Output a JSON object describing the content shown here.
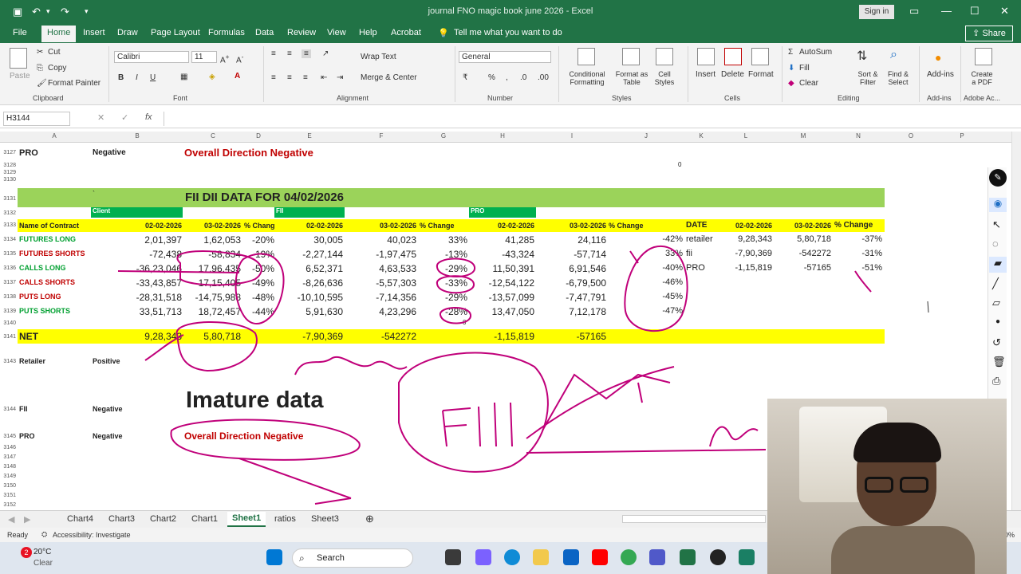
{
  "app": {
    "title": "journal FNO magic book june 2026  -  Excel",
    "signin": "Sign in",
    "share": "Share"
  },
  "ribbon_tabs": [
    "File",
    "Home",
    "Insert",
    "Draw",
    "Page Layout",
    "Formulas",
    "Data",
    "Review",
    "View",
    "Help",
    "Acrobat",
    "Tell me what you want to do"
  ],
  "ribbon": {
    "clipboard": {
      "paste": "Paste",
      "cut": "Cut",
      "copy": "Copy",
      "format_painter": "Format Painter",
      "label": "Clipboard"
    },
    "font": {
      "name": "Calibri",
      "size": "11",
      "bold": "B",
      "italic": "I",
      "underline": "U",
      "label": "Font"
    },
    "alignment": {
      "wrap": "Wrap Text",
      "merge": "Merge & Center",
      "label": "Alignment"
    },
    "number": {
      "format": "General",
      "label": "Number"
    },
    "styles": {
      "conditional": "Conditional Formatting",
      "format_table": "Format as Table",
      "cell_styles": "Cell Styles",
      "label": "Styles"
    },
    "cells": {
      "insert": "Insert",
      "delete": "Delete",
      "format": "Format",
      "label": "Cells"
    },
    "editing": {
      "autosum": "AutoSum",
      "fill": "Fill",
      "clear": "Clear",
      "sort": "Sort & Filter",
      "find": "Find & Select",
      "label": "Editing"
    },
    "addins": {
      "addins": "Add-ins",
      "label": "Add-ins"
    },
    "adobe": {
      "create_pdf": "Create a PDF",
      "label": "Adobe Ac..."
    }
  },
  "formula_bar": {
    "name_box": "H3144",
    "fx": "fx",
    "value": ""
  },
  "columns": [
    "A",
    "B",
    "C",
    "D",
    "E",
    "F",
    "G",
    "H",
    "I",
    "J",
    "K",
    "L",
    "M",
    "N",
    "O",
    "P"
  ],
  "rows": {
    "r3127": {
      "num": "3127",
      "a": "PRO",
      "b": "Negative",
      "c": "Overall Direction Negative"
    },
    "r3128": {
      "num": "3128",
      "j": "0"
    },
    "r3129": {
      "num": "3129"
    },
    "r3130": {
      "num": "3130"
    },
    "r3131": {
      "num": "3131",
      "b": "`",
      "title": "FII DII DATA  FOR  04/02/2026"
    },
    "r3132": {
      "num": "3132",
      "client": "Client",
      "fii": "FII",
      "pro": "PRO"
    },
    "r3133": {
      "num": "3133",
      "cells": [
        "Name of Contract",
        "02-02-2026",
        "03-02-2026",
        "% Chang",
        "02-02-2026",
        "03-02-2026",
        "% Change",
        "02-02-2026",
        "03-02-2026",
        "% Change",
        "DATE",
        "02-02-2026",
        "03-02-2026",
        "% Change"
      ]
    },
    "data": [
      {
        "num": "3134",
        "name": "FUTURES LONG",
        "cls": "green",
        "v": [
          "2,01,397",
          "1,62,053",
          "-20%",
          "30,005",
          "40,023",
          "33%",
          "41,285",
          "24,116",
          "-42%",
          "retailer",
          "9,28,343",
          "5,80,718",
          "-37%"
        ]
      },
      {
        "num": "3135",
        "name": "FUTURES SHORTS",
        "cls": "red",
        "v": [
          "-72,438",
          "-58,834",
          "-19%",
          "-2,27,144",
          "-1,97,475",
          "-13%",
          "-43,324",
          "-57,714",
          "33%",
          "fii",
          "-7,90,369",
          "-542272",
          "-31%"
        ]
      },
      {
        "num": "3136",
        "name": "CALLS LONG",
        "cls": "green",
        "v": [
          "-36,23,046",
          "17,96,435",
          "-50%",
          "6,52,371",
          "4,63,533",
          "-29%",
          "11,50,391",
          "6,91,546",
          "-40%",
          "PRO",
          "-1,15,819",
          "-57165",
          "-51%"
        ]
      },
      {
        "num": "3137",
        "name": "CALLS SHORTS",
        "cls": "red",
        "v": [
          "-33,43,857",
          "-17,15,405",
          "-49%",
          "-8,26,636",
          "-5,57,303",
          "-33%",
          "-12,54,122",
          "-6,79,500",
          "-46%",
          "",
          "",
          "",
          ""
        ]
      },
      {
        "num": "3138",
        "name": "PUTS LONG",
        "cls": "red",
        "v": [
          "-28,31,518",
          "-14,75,988",
          "-48%",
          "-10,10,595",
          "-7,14,356",
          "-29%",
          "-13,57,099",
          "-7,47,791",
          "-45%",
          "",
          "",
          "",
          ""
        ]
      },
      {
        "num": "3139",
        "name": "PUTS SHORTS",
        "cls": "green",
        "v": [
          "33,51,713",
          "18,72,457",
          "-44%",
          "5,91,630",
          "4,23,296",
          "-28%",
          "13,47,050",
          "7,12,178",
          "-47%",
          "",
          "",
          "",
          ""
        ]
      }
    ],
    "r3140": {
      "num": "3140",
      "g": "0"
    },
    "r3141": {
      "num": "3141",
      "a": "NET",
      "b": "9,28,343",
      "c": "5,80,718",
      "e": "-7,90,369",
      "f": "-542272",
      "h": "-1,15,819",
      "i": "-57165"
    },
    "r3143": {
      "num": "3143",
      "a": "Retailer",
      "b": "Positive"
    },
    "r3144": {
      "num": "3144",
      "a": "FII",
      "b": "Negative",
      "big": "Imature data"
    },
    "r3145": {
      "num": "3145",
      "a": "PRO",
      "b": "Negative",
      "c": "Overall Direction Negative"
    },
    "blank": [
      "3146",
      "3147",
      "3148",
      "3149",
      "3150",
      "3151",
      "3152"
    ]
  },
  "sheet_tabs": [
    "Chart4",
    "Chart3",
    "Chart2",
    "Chart1",
    "Sheet1",
    "ratios",
    "Sheet3"
  ],
  "active_sheet": "Sheet1",
  "status": {
    "ready": "Ready",
    "accessibility": "Accessibility: Investigate",
    "zoom": "70%"
  },
  "taskbar": {
    "weather_temp": "20°C",
    "weather_desc": "Clear",
    "badge": "2",
    "search": "Search"
  },
  "colors": {
    "excel_green": "#217346",
    "header_green": "#9bd35a",
    "band_green": "#00b050",
    "highlight_yellow": "#ffff00",
    "negative_red": "#c00000",
    "ink": "#c0007a"
  }
}
